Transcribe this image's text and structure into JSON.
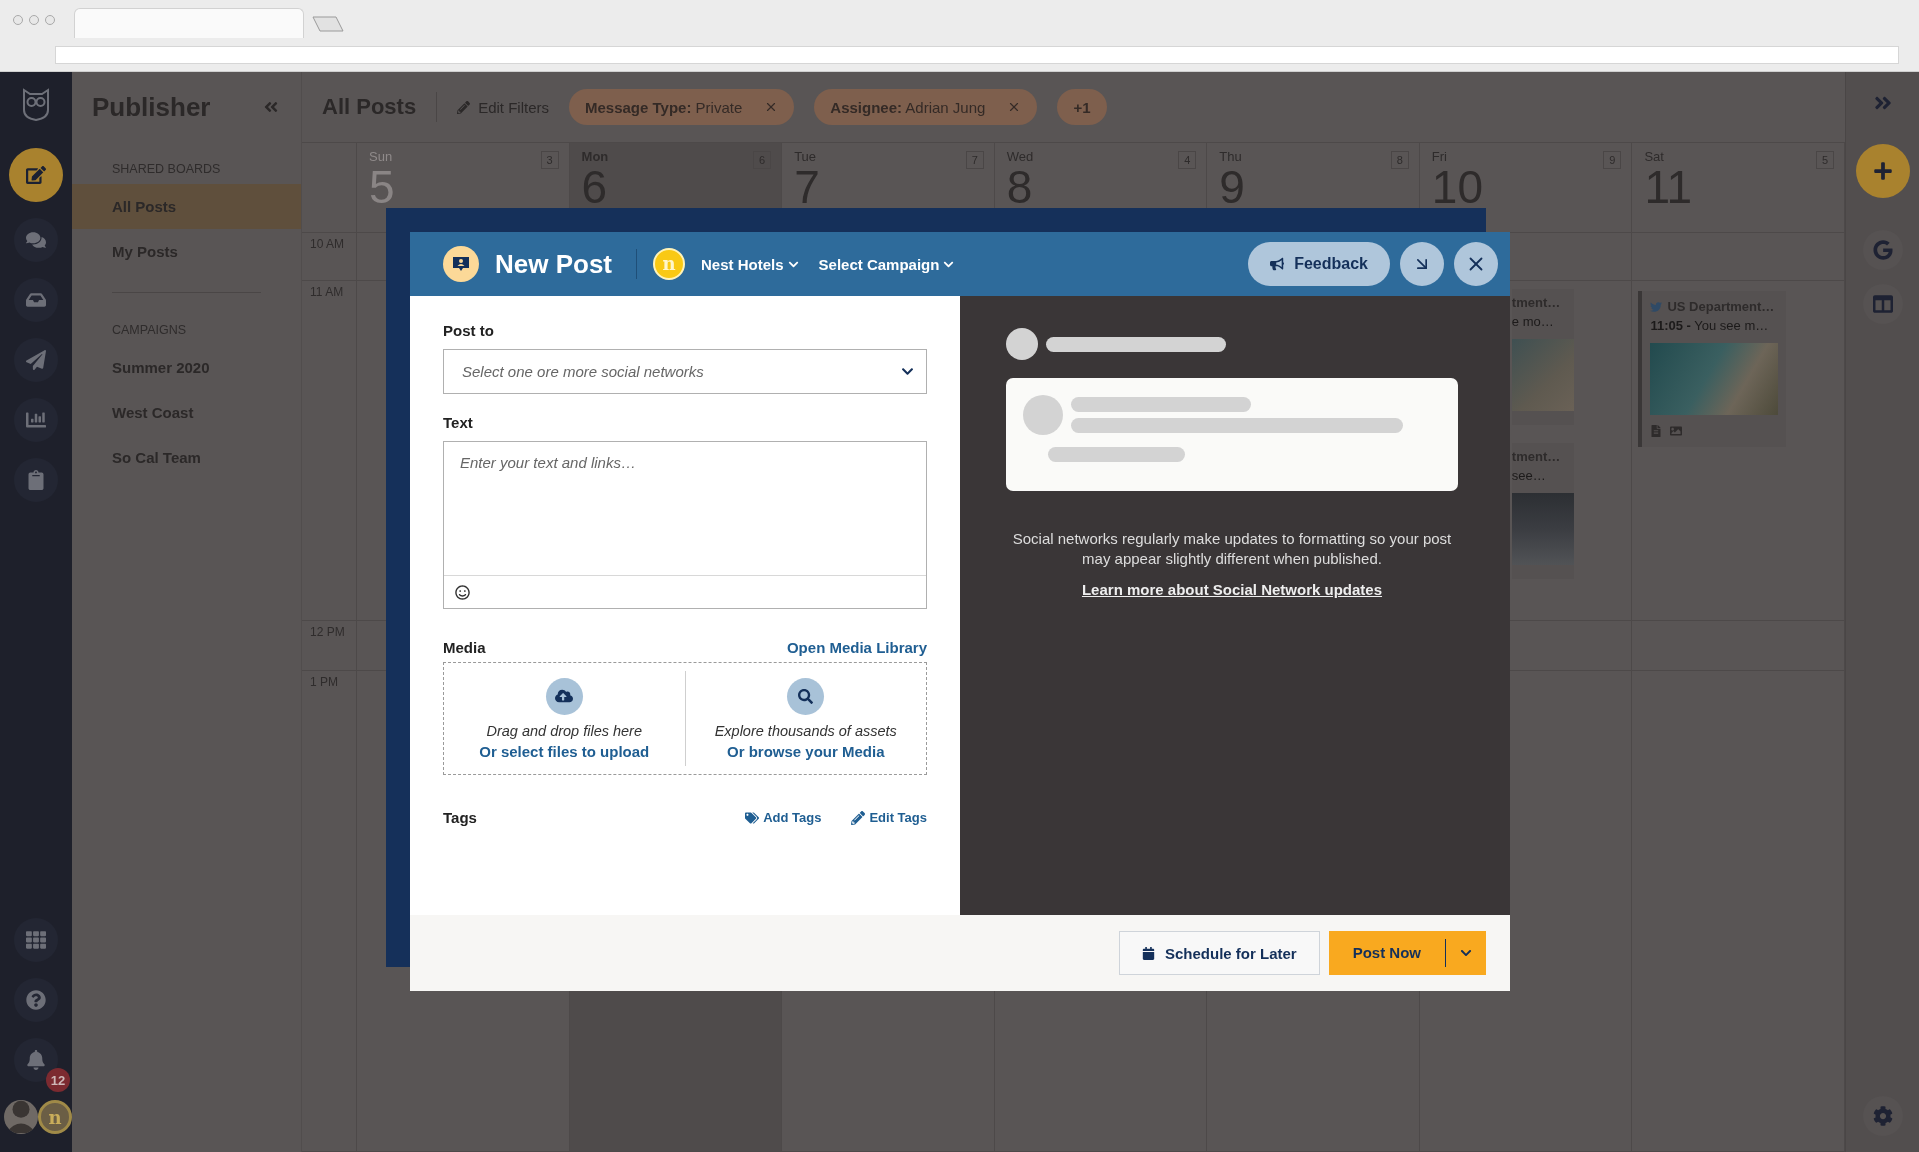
{
  "nav": {
    "top": [
      {
        "kind": "compose",
        "selected": true
      },
      {
        "kind": "streams",
        "selected": false
      },
      {
        "kind": "inbox",
        "selected": false
      },
      {
        "kind": "publisher",
        "selected": false
      },
      {
        "kind": "analytics",
        "selected": false
      },
      {
        "kind": "assignments",
        "selected": false
      }
    ],
    "bottom": [
      {
        "kind": "apps"
      },
      {
        "kind": "help"
      },
      {
        "kind": "notifications",
        "badge": "12"
      }
    ],
    "account": {
      "org_letter": "n"
    }
  },
  "sidebar": {
    "title": "Publisher",
    "sections": [
      {
        "heading": "SHARED BOARDS",
        "items": [
          {
            "label": "All Posts",
            "selected": true
          },
          {
            "label": "My Posts",
            "selected": false
          }
        ]
      },
      {
        "heading": "CAMPAIGNS",
        "items": [
          {
            "label": "Summer 2020",
            "selected": false
          },
          {
            "label": "West Coast",
            "selected": false
          },
          {
            "label": "So Cal Team",
            "selected": false
          }
        ]
      }
    ]
  },
  "header": {
    "title": "All Posts",
    "edit_filters": "Edit Filters",
    "filters": [
      {
        "label": "**Message Type:** Private"
      },
      {
        "label": "**Assignee:** Adrian Jung"
      }
    ],
    "more": "+1"
  },
  "calendar": {
    "times": [
      "10 AM",
      "11 AM",
      "12 PM",
      "1 PM"
    ],
    "days": [
      {
        "name": "Sun",
        "date": "5",
        "count": "3",
        "selected": false,
        "muted": true
      },
      {
        "name": "Mon",
        "date": "6",
        "count": "6",
        "selected": true,
        "muted": false
      },
      {
        "name": "Tue",
        "date": "7",
        "count": "7",
        "selected": false,
        "muted": false
      },
      {
        "name": "Wed",
        "date": "8",
        "count": "4",
        "selected": false,
        "muted": false
      },
      {
        "name": "Thu",
        "date": "9",
        "count": "8",
        "selected": false,
        "muted": false
      },
      {
        "name": "Fri",
        "date": "10",
        "count": "9",
        "selected": false,
        "muted": false,
        "posts": [
          {
            "kind": "clipped",
            "title": "tment…",
            "snippet": "e mo…"
          },
          {
            "kind": "clipped",
            "title": "tment…",
            "snippet": "see…"
          }
        ]
      },
      {
        "name": "Sat",
        "date": "11",
        "count": "5",
        "selected": false,
        "muted": false,
        "posts": [
          {
            "kind": "full",
            "title": "US Department…",
            "snippet": "**11:05 -** You see m…"
          }
        ]
      }
    ]
  },
  "right_rail": {
    "items": [
      {
        "kind": "expand"
      },
      {
        "kind": "create"
      },
      {
        "kind": "google"
      },
      {
        "kind": "columns"
      }
    ],
    "footer": [
      {
        "kind": "settings"
      }
    ]
  },
  "modal": {
    "title": "New Post",
    "org": {
      "letter": "n",
      "name": "Nest Hotels"
    },
    "campaign": "Select Campaign",
    "feedback": "Feedback",
    "post_to": {
      "label": "Post to",
      "placeholder": "Select one ore more social networks"
    },
    "text": {
      "label": "Text",
      "placeholder": "Enter your text and links…"
    },
    "media": {
      "label": "Media",
      "library_link": "Open Media Library",
      "upload": {
        "hint": "Drag and drop files here",
        "link": "Or select files to upload"
      },
      "browse": {
        "hint": "Explore thousands of assets",
        "link": "Or browse your Media"
      }
    },
    "tags": {
      "label": "Tags",
      "add": "Add Tags",
      "edit": "Edit Tags"
    },
    "preview": {
      "notice": "Social networks regularly make updates to formatting so your post may appear slightly different when published.",
      "link": "Learn more about Social Network updates"
    },
    "footer": {
      "schedule": "Schedule for Later",
      "post_now": "Post Now"
    }
  }
}
